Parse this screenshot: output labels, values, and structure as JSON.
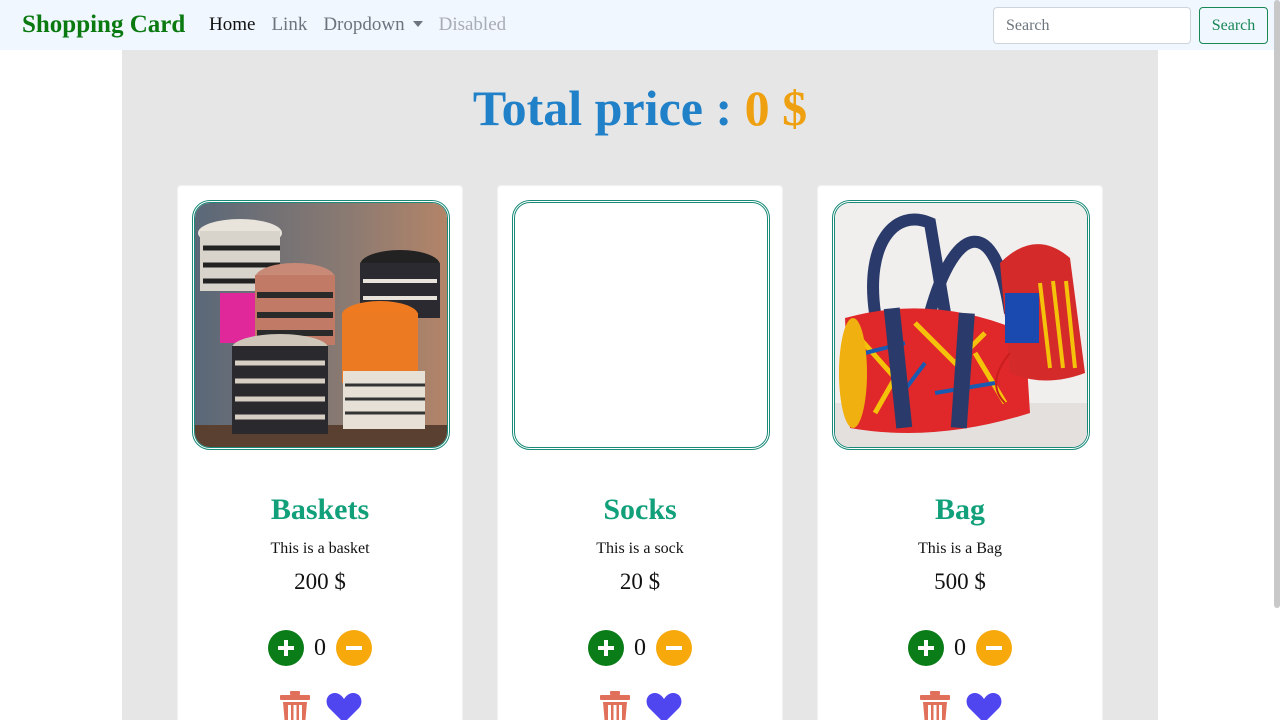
{
  "navbar": {
    "brand": "Shopping Card",
    "links": [
      {
        "label": "Home"
      },
      {
        "label": "Link"
      },
      {
        "label": "Dropdown"
      },
      {
        "label": "Disabled"
      }
    ],
    "search": {
      "placeholder": "Search",
      "button_label": "Search"
    }
  },
  "summary": {
    "label": "Total price : ",
    "amount": "0 $"
  },
  "products": [
    {
      "name": "Baskets",
      "description": "This is a basket",
      "price": "200 $",
      "quantity": "0",
      "image": "baskets-photo"
    },
    {
      "name": "Socks",
      "description": "This is a sock",
      "price": "20 $",
      "quantity": "0",
      "image": "socks-photo-missing"
    },
    {
      "name": "Bag",
      "description": "This is a Bag",
      "price": "500 $",
      "quantity": "0",
      "image": "bag-photo"
    }
  ],
  "icons": {
    "plus": "plus-icon",
    "minus": "minus-icon",
    "trash": "trash-icon",
    "heart": "heart-icon"
  },
  "colors": {
    "brand": "#0a7a10",
    "total_label": "#2080c8",
    "total_amount": "#eea010",
    "product_title": "#11a07a",
    "plus_button": "#0a7d18",
    "minus_button": "#f7a90c",
    "trash": "#e0705a",
    "heart": "#5046f0"
  }
}
